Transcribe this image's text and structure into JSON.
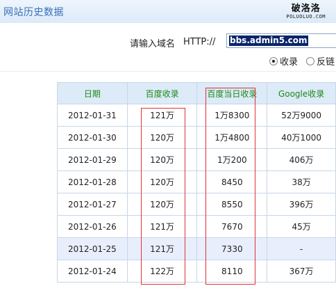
{
  "header": {
    "title": "网站历史数据",
    "logo_cn": "破洛洛",
    "logo_en": "POLUOLUO.COM"
  },
  "query": {
    "label": "请输入域名",
    "prefix": "HTTP://",
    "domain_value": "bbs.admin5.com",
    "options": [
      {
        "label": "收录",
        "selected": true
      },
      {
        "label": "反链",
        "selected": false
      }
    ]
  },
  "table": {
    "headers": [
      "日期",
      "百度收录",
      "百度当日收录",
      "Google收录"
    ],
    "rows": [
      [
        "2012-01-31",
        "121万",
        "1万8300",
        "52万9000"
      ],
      [
        "2012-01-30",
        "120万",
        "1万4800",
        "40万1000"
      ],
      [
        "2012-01-29",
        "120万",
        "1万200",
        "406万"
      ],
      [
        "2012-01-28",
        "120万",
        "8450",
        "38万"
      ],
      [
        "2012-01-27",
        "120万",
        "8550",
        "396万"
      ],
      [
        "2012-01-26",
        "121万",
        "7670",
        "45万"
      ],
      [
        "2012-01-25",
        "121万",
        "7330",
        "-"
      ],
      [
        "2012-01-24",
        "122万",
        "8110",
        "367万"
      ]
    ],
    "highlighted_row": 6
  },
  "colors": {
    "header_text": "#1a8a1a",
    "title_text": "#3a6fb7",
    "annotation_box": "#e23131",
    "selection": "#0a246a"
  }
}
